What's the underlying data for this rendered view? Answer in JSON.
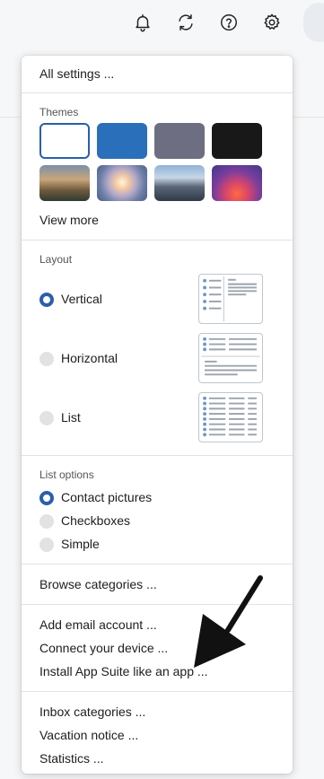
{
  "topbar": {
    "icons": [
      "bell-icon",
      "refresh-icon",
      "help-icon",
      "gear-icon"
    ]
  },
  "menu": {
    "all_settings": "All settings ...",
    "themes": {
      "title": "Themes",
      "swatches": [
        {
          "name": "white",
          "color": "#ffffff",
          "selected": true
        },
        {
          "name": "blue",
          "color": "#2a6fba"
        },
        {
          "name": "gray",
          "color": "#6e6e82"
        },
        {
          "name": "black",
          "color": "#181818"
        },
        {
          "name": "mountain-photo"
        },
        {
          "name": "beach-sunset-photo"
        },
        {
          "name": "city-skyline-photo"
        },
        {
          "name": "purple-glow"
        }
      ],
      "view_more": "View more"
    },
    "layout": {
      "title": "Layout",
      "options": [
        {
          "label": "Vertical",
          "selected": true
        },
        {
          "label": "Horizontal",
          "selected": false
        },
        {
          "label": "List",
          "selected": false
        }
      ]
    },
    "list_options": {
      "title": "List options",
      "options": [
        {
          "label": "Contact pictures",
          "selected": true
        },
        {
          "label": "Checkboxes",
          "selected": false
        },
        {
          "label": "Simple",
          "selected": false
        }
      ]
    },
    "browse_categories": "Browse categories ...",
    "add_email_account": "Add email account ...",
    "connect_device": "Connect your device ...",
    "install_app": "Install App Suite like an app ...",
    "inbox_categories": "Inbox categories ...",
    "vacation_notice": "Vacation notice ...",
    "statistics": "Statistics ..."
  },
  "colors": {
    "accent": "#2a5fab",
    "thumb_dot": "#6f95c9",
    "thumb_line": "#9aa3ad"
  }
}
